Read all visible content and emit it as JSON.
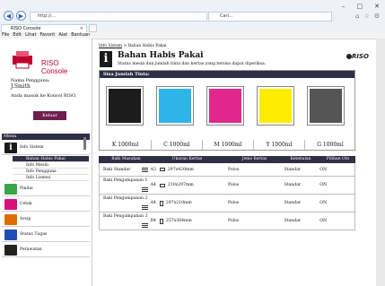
{
  "browser": {
    "address_text": "http://...",
    "search_placeholder": "Cari...",
    "tab_title": "RISO Console",
    "menu": [
      "File",
      "Edit",
      "Lihat",
      "Favorit",
      "Alat",
      "Bantuan"
    ],
    "window_controls": [
      "–",
      "□",
      "✕"
    ]
  },
  "sidebar": {
    "logo": "RISO Console",
    "user_label": "Nama Pengguna:",
    "user_name": "J.Smith",
    "login_label": "Anda masuk ke Konsol RISO.",
    "logout_label": "Keluar",
    "menu_title": "Menu",
    "items": [
      {
        "label": "Info Sistem",
        "icon": "info-icon",
        "color": "#1a1a1a"
      },
      {
        "label": "Pindai",
        "icon": "scan-icon",
        "color": "#3aa64a"
      },
      {
        "label": "Cetak",
        "icon": "print-icon",
        "color": "#d8107c"
      },
      {
        "label": "Arsip",
        "icon": "archive-icon",
        "color": "#e06b00"
      },
      {
        "label": "Status Tugas",
        "icon": "job-status-icon",
        "color": "#1e4fb5"
      },
      {
        "label": "Perawatan",
        "icon": "maintenance-icon",
        "color": "#222222"
      }
    ],
    "subitems": [
      "Bahan Habis Pakai",
      "Info Mesin",
      "Info Pengguna",
      "Info Lisensi"
    ]
  },
  "main": {
    "breadcrumb_link": "Info Sistem",
    "breadcrumb_current": " > Bahan Habis Pakai",
    "title": "Bahan Habis Pakai",
    "description": "Status mesin dan jumlah tinta dan kertas yang tersisa dapat diperiksa.",
    "brand": "RISO",
    "ink_title": "Sisa Jumlah Tinta:",
    "inks": [
      {
        "label": "K 1000ml",
        "color": "#1c1c1c"
      },
      {
        "label": "C 1000ml",
        "color": "#2fb4e8"
      },
      {
        "label": "M 1000ml",
        "color": "#e0288c"
      },
      {
        "label": "Y 1000ml",
        "color": "#ffed00"
      },
      {
        "label": "G 1000ml",
        "color": "#555555"
      }
    ],
    "table": {
      "headers": [
        "Baki Masukan",
        "Ukuran Kertas",
        "Jenis Kertas",
        "Ketebalan",
        "Pilihan Oto"
      ],
      "rows": [
        {
          "tray": "Baki Standar",
          "size_code": "A3",
          "size": "297x420mm",
          "type": "Polos",
          "thickness": "Standar",
          "auto": "ON"
        },
        {
          "tray": "Baki Pengumpanan 1",
          "size_code": "A4",
          "size": "210x297mm",
          "type": "Polos",
          "thickness": "Standar",
          "auto": "ON"
        },
        {
          "tray": "Baki Pengumpanan 2",
          "size_code": "A4",
          "size": "297x210mm",
          "type": "Polos",
          "thickness": "Standar",
          "auto": "ON"
        },
        {
          "tray": "Baki Pengumpanan 3",
          "size_code": "B4",
          "size": "257x364mm",
          "type": "Polos",
          "thickness": "Standar",
          "auto": "ON"
        }
      ]
    }
  }
}
